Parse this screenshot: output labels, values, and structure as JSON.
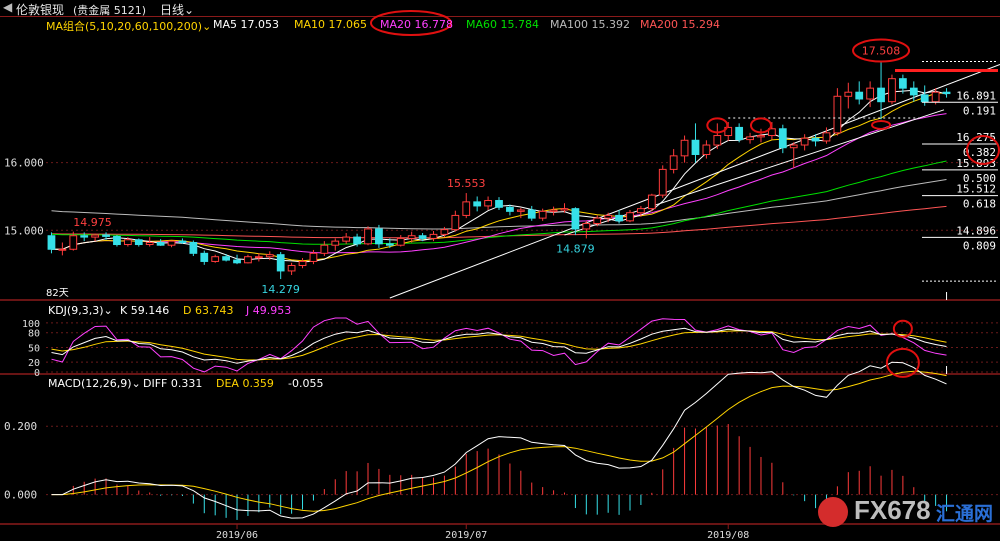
{
  "header": {
    "instrument": "伦敦银现",
    "market": "(贵金属 5121)",
    "period": "日线"
  },
  "ma_legend": {
    "group": "MA组合(5,10,20,60,100,200)",
    "items": [
      {
        "label": "MA5 17.053",
        "color": "#ffffff"
      },
      {
        "label": "MA10 17.065",
        "color": "#ffd400"
      },
      {
        "label": "MA20 16.778",
        "color": "#ff40ff"
      },
      {
        "label": "MA60 15.784",
        "color": "#00e000"
      },
      {
        "label": "MA100 15.392",
        "color": "#bbbbbb"
      },
      {
        "label": "MA200 15.294",
        "color": "#ff5555"
      }
    ]
  },
  "kdj_legend": {
    "group": "KDJ(9,3,3)",
    "items": [
      {
        "label": "K 59.146",
        "color": "#ffffff"
      },
      {
        "label": "D 63.743",
        "color": "#ffd400"
      },
      {
        "label": "J 49.953",
        "color": "#ff40ff"
      }
    ]
  },
  "macd_legend": {
    "group": "MACD(12,26,9)",
    "items": [
      {
        "label": "DIFF 0.331",
        "color": "#ffffff"
      },
      {
        "label": "DEA 0.359",
        "color": "#ffd400"
      },
      {
        "label": "-0.055",
        "color": "#ffffff"
      }
    ]
  },
  "watermark": {
    "brand": "FX678",
    "cn": "汇通网"
  },
  "chart_data": {
    "type": "candlestick",
    "price_axis": {
      "ylim": [
        14.0,
        17.9
      ],
      "ticks": [
        {
          "value": 16.0,
          "label": "16.000"
        },
        {
          "value": 15.0,
          "label": "15.000"
        }
      ]
    },
    "x_axis_labels": [
      {
        "label": "2019/06",
        "index": 17
      },
      {
        "label": "2019/07",
        "index": 38
      },
      {
        "label": "2019/08",
        "index": 62
      }
    ],
    "candles": [
      {
        "o": 14.92,
        "h": 14.97,
        "l": 14.66,
        "c": 14.72
      },
      {
        "o": 14.72,
        "h": 14.82,
        "l": 14.63,
        "c": 14.72
      },
      {
        "o": 14.72,
        "h": 14.98,
        "l": 14.7,
        "c": 14.92
      },
      {
        "o": 14.92,
        "h": 14.97,
        "l": 14.84,
        "c": 14.9
      },
      {
        "o": 14.9,
        "h": 14.95,
        "l": 14.84,
        "c": 14.93
      },
      {
        "o": 14.93,
        "h": 14.97,
        "l": 14.86,
        "c": 14.91
      },
      {
        "o": 14.91,
        "h": 14.93,
        "l": 14.76,
        "c": 14.79
      },
      {
        "o": 14.79,
        "h": 14.9,
        "l": 14.76,
        "c": 14.86
      },
      {
        "o": 14.86,
        "h": 14.88,
        "l": 14.76,
        "c": 14.79
      },
      {
        "o": 14.79,
        "h": 14.9,
        "l": 14.76,
        "c": 14.82
      },
      {
        "o": 14.82,
        "h": 14.87,
        "l": 14.77,
        "c": 14.78
      },
      {
        "o": 14.78,
        "h": 14.85,
        "l": 14.75,
        "c": 14.84
      },
      {
        "o": 14.84,
        "h": 14.88,
        "l": 14.8,
        "c": 14.82
      },
      {
        "o": 14.82,
        "h": 14.85,
        "l": 14.62,
        "c": 14.66
      },
      {
        "o": 14.66,
        "h": 14.7,
        "l": 14.49,
        "c": 14.54
      },
      {
        "o": 14.54,
        "h": 14.64,
        "l": 14.52,
        "c": 14.61
      },
      {
        "o": 14.61,
        "h": 14.65,
        "l": 14.54,
        "c": 14.56
      },
      {
        "o": 14.56,
        "h": 14.64,
        "l": 14.5,
        "c": 14.52
      },
      {
        "o": 14.52,
        "h": 14.64,
        "l": 14.51,
        "c": 14.61
      },
      {
        "o": 14.61,
        "h": 14.66,
        "l": 14.54,
        "c": 14.61
      },
      {
        "o": 14.61,
        "h": 14.69,
        "l": 14.56,
        "c": 14.64
      },
      {
        "o": 14.64,
        "h": 14.68,
        "l": 14.28,
        "c": 14.4
      },
      {
        "o": 14.4,
        "h": 14.52,
        "l": 14.34,
        "c": 14.48
      },
      {
        "o": 14.48,
        "h": 14.59,
        "l": 14.44,
        "c": 14.54
      },
      {
        "o": 14.54,
        "h": 14.71,
        "l": 14.5,
        "c": 14.66
      },
      {
        "o": 14.66,
        "h": 14.84,
        "l": 14.62,
        "c": 14.78
      },
      {
        "o": 14.78,
        "h": 14.88,
        "l": 14.7,
        "c": 14.84
      },
      {
        "o": 14.84,
        "h": 14.96,
        "l": 14.8,
        "c": 14.9
      },
      {
        "o": 14.9,
        "h": 14.95,
        "l": 14.76,
        "c": 14.8
      },
      {
        "o": 14.8,
        "h": 15.06,
        "l": 14.78,
        "c": 15.02
      },
      {
        "o": 15.02,
        "h": 15.08,
        "l": 14.74,
        "c": 14.8
      },
      {
        "o": 14.8,
        "h": 14.88,
        "l": 14.74,
        "c": 14.78
      },
      {
        "o": 14.78,
        "h": 14.93,
        "l": 14.76,
        "c": 14.88
      },
      {
        "o": 14.88,
        "h": 14.98,
        "l": 14.82,
        "c": 14.92
      },
      {
        "o": 14.92,
        "h": 14.96,
        "l": 14.84,
        "c": 14.88
      },
      {
        "o": 14.88,
        "h": 14.99,
        "l": 14.84,
        "c": 14.94
      },
      {
        "o": 14.94,
        "h": 15.05,
        "l": 14.9,
        "c": 15.01
      },
      {
        "o": 15.01,
        "h": 15.29,
        "l": 14.98,
        "c": 15.22
      },
      {
        "o": 15.22,
        "h": 15.55,
        "l": 15.18,
        "c": 15.42
      },
      {
        "o": 15.42,
        "h": 15.5,
        "l": 15.28,
        "c": 15.36
      },
      {
        "o": 15.36,
        "h": 15.5,
        "l": 15.3,
        "c": 15.44
      },
      {
        "o": 15.44,
        "h": 15.49,
        "l": 15.3,
        "c": 15.34
      },
      {
        "o": 15.34,
        "h": 15.38,
        "l": 15.22,
        "c": 15.28
      },
      {
        "o": 15.28,
        "h": 15.33,
        "l": 15.18,
        "c": 15.3
      },
      {
        "o": 15.3,
        "h": 15.36,
        "l": 15.14,
        "c": 15.18
      },
      {
        "o": 15.18,
        "h": 15.32,
        "l": 15.14,
        "c": 15.28
      },
      {
        "o": 15.28,
        "h": 15.35,
        "l": 15.22,
        "c": 15.3
      },
      {
        "o": 15.3,
        "h": 15.4,
        "l": 15.26,
        "c": 15.32
      },
      {
        "o": 15.32,
        "h": 15.34,
        "l": 14.93,
        "c": 15.02
      },
      {
        "o": 15.02,
        "h": 15.14,
        "l": 14.88,
        "c": 15.1
      },
      {
        "o": 15.1,
        "h": 15.22,
        "l": 15.06,
        "c": 15.18
      },
      {
        "o": 15.18,
        "h": 15.26,
        "l": 15.12,
        "c": 15.22
      },
      {
        "o": 15.22,
        "h": 15.3,
        "l": 15.1,
        "c": 15.14
      },
      {
        "o": 15.14,
        "h": 15.3,
        "l": 15.12,
        "c": 15.26
      },
      {
        "o": 15.26,
        "h": 15.36,
        "l": 15.2,
        "c": 15.32
      },
      {
        "o": 15.32,
        "h": 15.54,
        "l": 15.28,
        "c": 15.52
      },
      {
        "o": 15.52,
        "h": 15.96,
        "l": 15.48,
        "c": 15.9
      },
      {
        "o": 15.9,
        "h": 16.2,
        "l": 15.84,
        "c": 16.1
      },
      {
        "o": 16.1,
        "h": 16.4,
        "l": 16.0,
        "c": 16.33
      },
      {
        "o": 16.33,
        "h": 16.58,
        "l": 16.0,
        "c": 16.12
      },
      {
        "o": 16.12,
        "h": 16.33,
        "l": 16.06,
        "c": 16.26
      },
      {
        "o": 16.26,
        "h": 16.58,
        "l": 16.2,
        "c": 16.4
      },
      {
        "o": 16.4,
        "h": 16.6,
        "l": 16.32,
        "c": 16.52
      },
      {
        "o": 16.52,
        "h": 16.58,
        "l": 16.3,
        "c": 16.34
      },
      {
        "o": 16.34,
        "h": 16.44,
        "l": 16.28,
        "c": 16.38
      },
      {
        "o": 16.38,
        "h": 16.5,
        "l": 16.3,
        "c": 16.4
      },
      {
        "o": 16.4,
        "h": 16.6,
        "l": 16.34,
        "c": 16.5
      },
      {
        "o": 16.5,
        "h": 16.56,
        "l": 16.14,
        "c": 16.22
      },
      {
        "o": 16.22,
        "h": 16.3,
        "l": 15.92,
        "c": 16.26
      },
      {
        "o": 16.26,
        "h": 16.42,
        "l": 16.18,
        "c": 16.36
      },
      {
        "o": 16.36,
        "h": 16.42,
        "l": 16.24,
        "c": 16.32
      },
      {
        "o": 16.32,
        "h": 16.52,
        "l": 16.28,
        "c": 16.44
      },
      {
        "o": 16.44,
        "h": 17.1,
        "l": 16.4,
        "c": 16.98
      },
      {
        "o": 16.98,
        "h": 17.18,
        "l": 16.8,
        "c": 17.04
      },
      {
        "o": 17.04,
        "h": 17.2,
        "l": 16.86,
        "c": 16.94
      },
      {
        "o": 16.94,
        "h": 17.2,
        "l": 16.82,
        "c": 17.1
      },
      {
        "o": 17.1,
        "h": 17.508,
        "l": 16.64,
        "c": 16.9
      },
      {
        "o": 16.9,
        "h": 17.3,
        "l": 16.86,
        "c": 17.24
      },
      {
        "o": 17.24,
        "h": 17.3,
        "l": 17.02,
        "c": 17.1
      },
      {
        "o": 17.1,
        "h": 17.2,
        "l": 16.9,
        "c": 17.0
      },
      {
        "o": 17.0,
        "h": 17.14,
        "l": 16.84,
        "c": 16.9
      },
      {
        "o": 16.9,
        "h": 17.1,
        "l": 16.86,
        "c": 17.04
      },
      {
        "o": 17.04,
        "h": 17.1,
        "l": 16.96,
        "c": 17.02
      }
    ],
    "annotations": [
      {
        "label": "17.508",
        "value": 17.508,
        "index": 76
      },
      {
        "label": "15.553",
        "value": 15.553,
        "index": 38
      },
      {
        "label": "14.975",
        "value": 14.975,
        "index": 2
      },
      {
        "label": "14.879",
        "value": 14.879,
        "index": 48
      },
      {
        "label": "14.279",
        "value": 14.279,
        "index": 21
      }
    ],
    "days_label": "82天",
    "fib_levels": [
      {
        "value": 16.891,
        "ratio": "0.191"
      },
      {
        "value": 16.275,
        "ratio": "0.382"
      },
      {
        "value": 15.893,
        "ratio": "0.500"
      },
      {
        "value": 15.512,
        "ratio": "0.618"
      },
      {
        "value": 14.896,
        "ratio": "0.809"
      }
    ],
    "kdj_axis": {
      "ylim": [
        0,
        110
      ],
      "ticks": [
        100,
        80,
        50,
        20,
        0
      ]
    },
    "macd_axis": {
      "ylim": [
        -0.08,
        0.3
      ],
      "ticks": [
        {
          "value": 0.2,
          "label": "0.200"
        },
        {
          "value": 0.0,
          "label": "0.000"
        }
      ]
    }
  }
}
